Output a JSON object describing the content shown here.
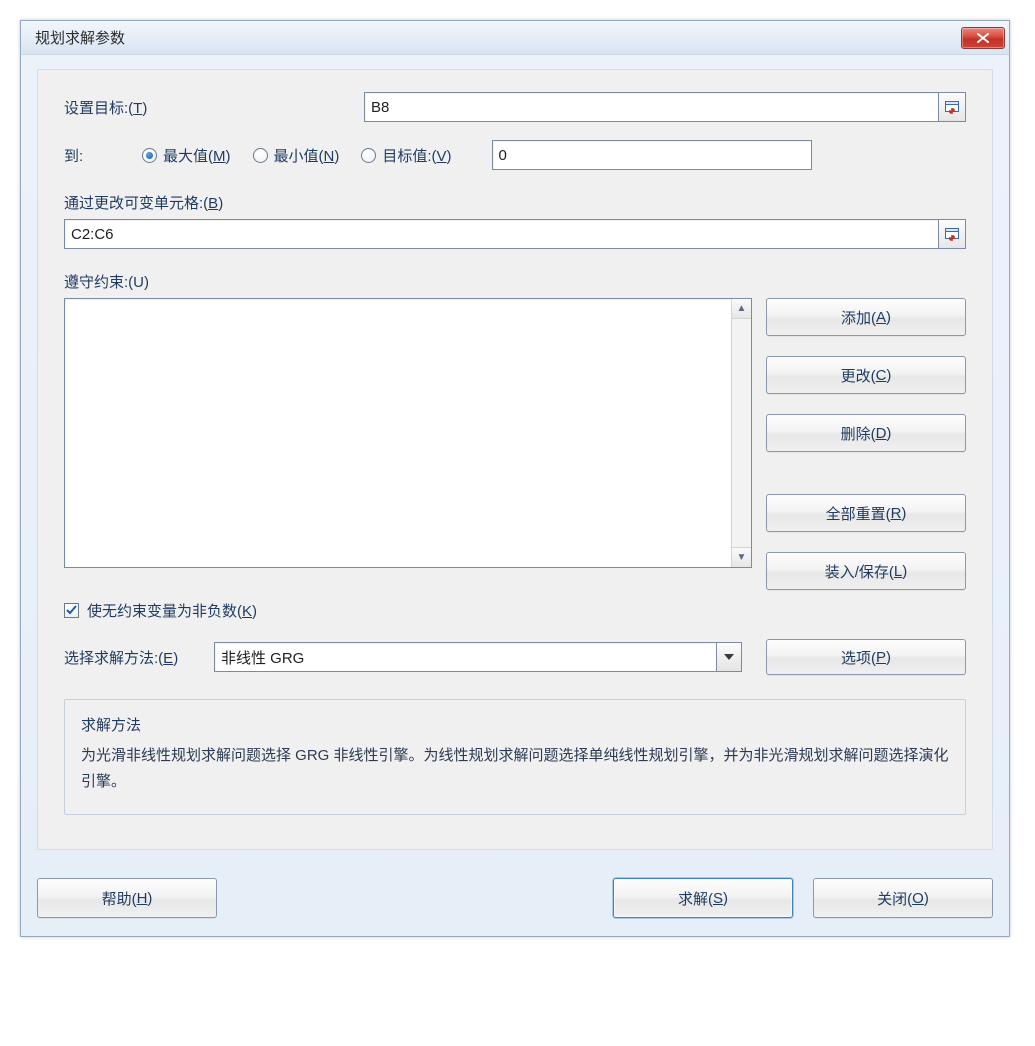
{
  "window": {
    "title": "规划求解参数"
  },
  "target": {
    "label_pre": "设置目标:(",
    "accel": "T",
    "label_post": ")",
    "value": "B8"
  },
  "to": {
    "label": "到:",
    "options": {
      "max": {
        "pre": "最大值(",
        "accel": "M",
        "post": ")",
        "selected": true
      },
      "min": {
        "pre": "最小值(",
        "accel": "N",
        "post": ")",
        "selected": false
      },
      "valueof": {
        "pre": "目标值:(",
        "accel": "V",
        "post": ")",
        "selected": false
      }
    },
    "value": "0"
  },
  "changing": {
    "pre": "通过更改可变单元格:(",
    "accel": "B",
    "post": ")",
    "value": "C2:C6"
  },
  "constraints": {
    "pre": "遵守约束:(",
    "accel_raw": "U",
    "post": ")",
    "items": []
  },
  "buttons": {
    "add": {
      "pre": "添加(",
      "accel": "A",
      "post": ")"
    },
    "change": {
      "pre": "更改(",
      "accel": "C",
      "post": ")"
    },
    "delete": {
      "pre": "删除(",
      "accel": "D",
      "post": ")"
    },
    "reset": {
      "pre": "全部重置(",
      "accel": "R",
      "post": ")"
    },
    "load": {
      "pre": "装入/保存(",
      "accel": "L",
      "post": ")"
    },
    "options": {
      "pre": "选项(",
      "accel": "P",
      "post": ")"
    },
    "help": {
      "pre": "帮助(",
      "accel": "H",
      "post": ")"
    },
    "solve": {
      "pre": "求解(",
      "accel": "S",
      "post": ")"
    },
    "close": {
      "pre": "关闭(",
      "accel": "O",
      "post": ")"
    }
  },
  "nonneg": {
    "pre": "使无约束变量为非负数(",
    "accel": "K",
    "post": ")",
    "checked": true
  },
  "method": {
    "label_pre": "选择求解方法:(",
    "accel": "E",
    "label_post": ")",
    "selected": "非线性 GRG"
  },
  "help_group": {
    "title": "求解方法",
    "text": "为光滑非线性规划求解问题选择 GRG 非线性引擎。为线性规划求解问题选择单纯线性规划引擎，并为非光滑规划求解问题选择演化引擎。"
  }
}
